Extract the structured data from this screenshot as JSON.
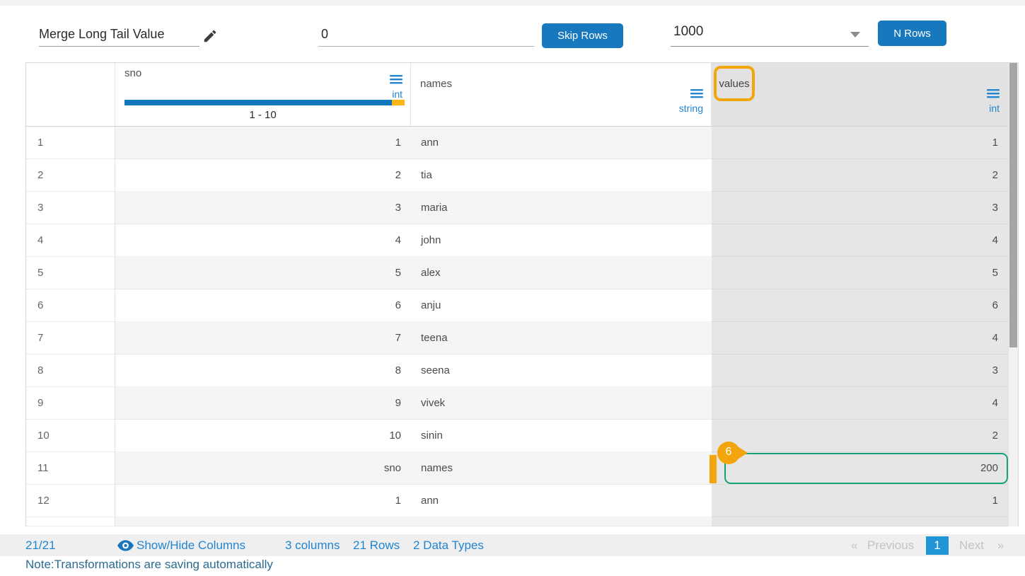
{
  "toolbar": {
    "transform_name": "Merge Long Tail Value",
    "skip_rows_value": "0",
    "skip_rows_button": "Skip Rows",
    "n_rows_value": "1000",
    "n_rows_button": "N Rows"
  },
  "table": {
    "columns": [
      {
        "name": "sno",
        "type": "int",
        "histogram": {
          "range_label": "1 - 10"
        }
      },
      {
        "name": "names",
        "type": "string"
      },
      {
        "name": "values",
        "type": "int",
        "selected": true
      }
    ],
    "rows": [
      {
        "index": "1",
        "sno": "1",
        "names": "ann",
        "values": "1"
      },
      {
        "index": "2",
        "sno": "2",
        "names": "tia",
        "values": "2"
      },
      {
        "index": "3",
        "sno": "3",
        "names": "maria",
        "values": "3"
      },
      {
        "index": "4",
        "sno": "4",
        "names": "john",
        "values": "4"
      },
      {
        "index": "5",
        "sno": "5",
        "names": "alex",
        "values": "5"
      },
      {
        "index": "6",
        "sno": "6",
        "names": "anju",
        "values": "6"
      },
      {
        "index": "7",
        "sno": "7",
        "names": "teena",
        "values": "4"
      },
      {
        "index": "8",
        "sno": "8",
        "names": "seena",
        "values": "3"
      },
      {
        "index": "9",
        "sno": "9",
        "names": "vivek",
        "values": "4"
      },
      {
        "index": "10",
        "sno": "10",
        "names": "sinin",
        "values": "2"
      },
      {
        "index": "11",
        "sno": "sno",
        "names": "names",
        "values": "200",
        "highlighted": true
      },
      {
        "index": "12",
        "sno": "1",
        "names": "ann",
        "values": "1"
      }
    ],
    "annotation_badge": "6"
  },
  "footer": {
    "rows_shown": "21/21",
    "show_hide_label": "Show/Hide Columns",
    "columns_summary": "3 columns",
    "rows_summary": "21 Rows",
    "types_summary": "2 Data Types",
    "prev_icon": "«",
    "prev_label": "Previous",
    "page": "1",
    "next_label": "Next",
    "next_icon": "»",
    "note": "Note:Transformations are saving automatically"
  },
  "colors": {
    "button_blue": "#1878be",
    "link_blue": "#2185d0",
    "histogram_blue": "#1276bd",
    "histogram_yellow": "#fdb515",
    "annotation_orange": "#f2a50c",
    "selection_teal": "#15a179",
    "selected_column_gray": "#e6e6e6"
  }
}
